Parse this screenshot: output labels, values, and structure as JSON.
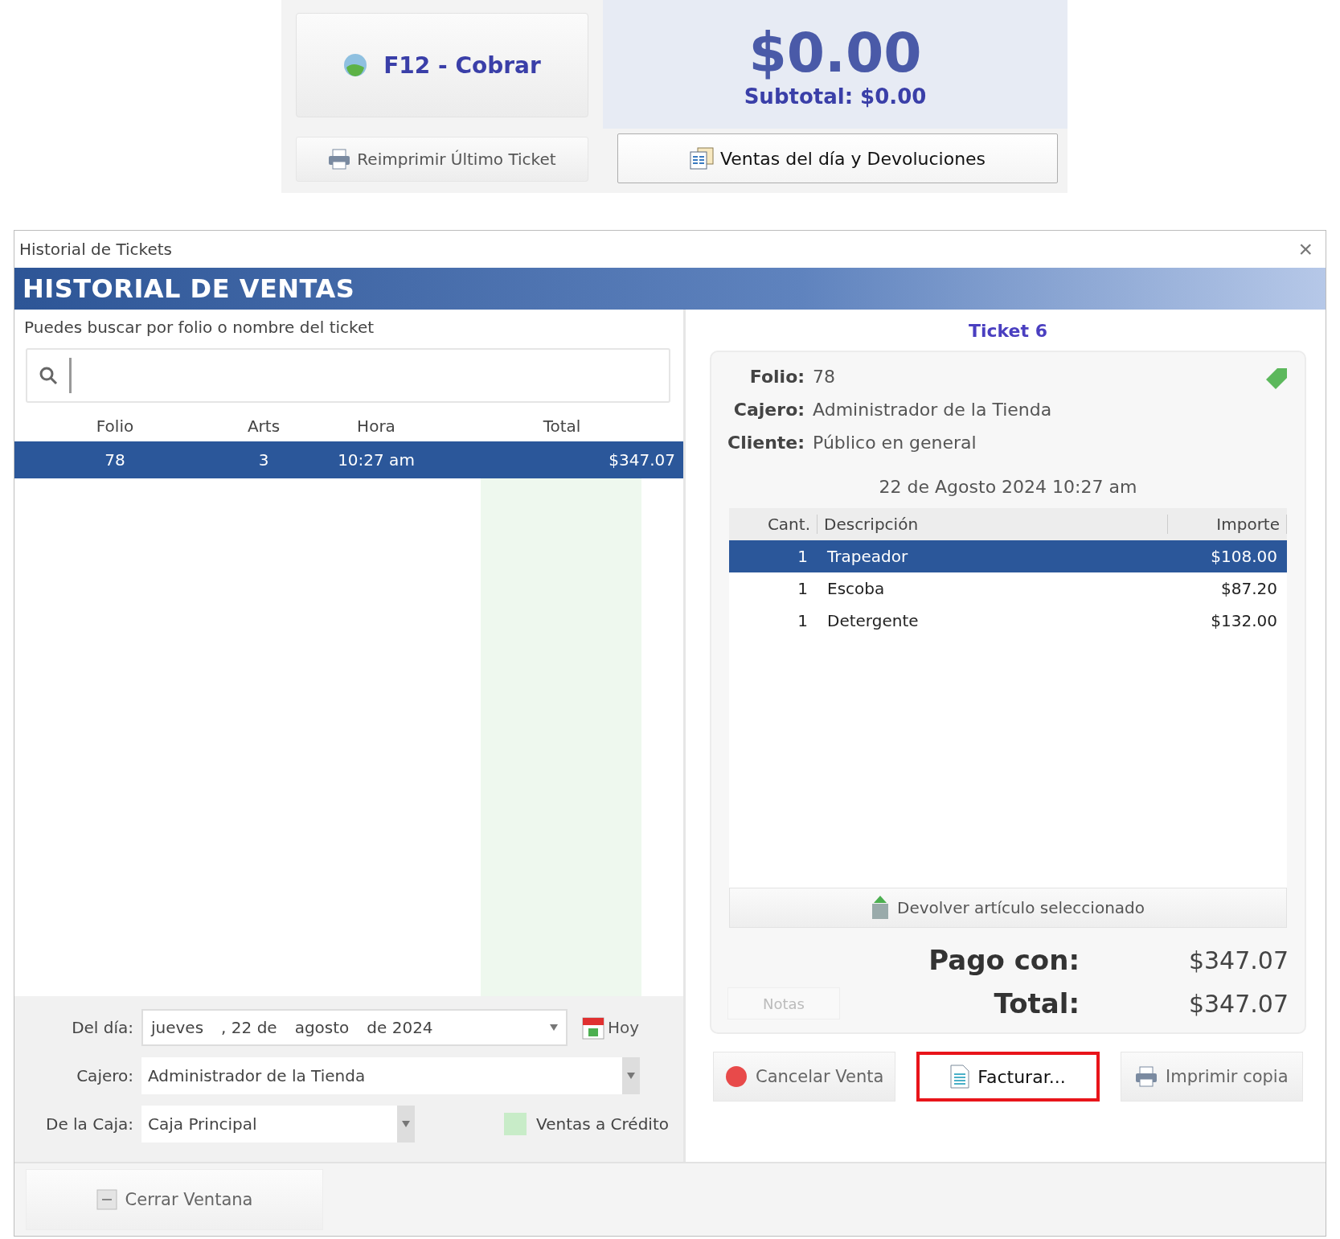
{
  "top_bar": {
    "charge_button": "F12 - Cobrar",
    "total": "$0.00",
    "subtotal": "Subtotal: $0.00",
    "reprint_button": "Reimprimir Último Ticket",
    "sales_button": "Ventas del día y Devoluciones"
  },
  "window": {
    "title": "Historial de Tickets",
    "header": "HISTORIAL DE VENTAS",
    "close": "×"
  },
  "search": {
    "hint": "Puedes buscar por folio o nombre del ticket"
  },
  "tickets": {
    "columns": [
      "Folio",
      "Arts",
      "Hora",
      "Total"
    ],
    "rows": [
      {
        "cells": [
          "78",
          "3",
          "10:27 am",
          "$347.07"
        ],
        "selected": true
      }
    ]
  },
  "filters": {
    "day_label": "Del día:",
    "date": [
      "jueves",
      ", 22 de",
      "agosto",
      "de 2024"
    ],
    "today_button": "Hoy",
    "cashier_label": "Cajero:",
    "cashier": "Administrador de la Tienda",
    "register_label": "De la Caja:",
    "register": "Caja Principal",
    "credit_legend": {
      "label": "Ventas a Crédito",
      "color": "#c8ecc8"
    }
  },
  "ticket": {
    "title": "Ticket 6",
    "fields": [
      {
        "label": "Folio:",
        "value": "78"
      },
      {
        "label": "Cajero:",
        "value": "Administrador de la Tienda"
      },
      {
        "label": "Cliente:",
        "value": "Público en general"
      }
    ],
    "date": "22 de Agosto 2024 10:27 am",
    "columns": [
      "Cant.",
      "Descripción",
      "Importe"
    ],
    "items": [
      {
        "cells": [
          "1",
          "Trapeador",
          "$108.00"
        ],
        "selected": true
      },
      {
        "cells": [
          "1",
          "Escoba",
          "$87.20"
        ],
        "selected": false
      },
      {
        "cells": [
          "1",
          "Detergente",
          "$132.00"
        ],
        "selected": false
      }
    ],
    "return_button": "Devolver artículo seleccionado",
    "notes_button": "Notas",
    "paid_label": "Pago con:",
    "paid": "$347.07",
    "total_label": "Total:",
    "total": "$347.07"
  },
  "actions": [
    {
      "label": "Cancelar Venta",
      "highlighted": false,
      "kind": "cancel"
    },
    {
      "label": "Facturar...",
      "highlighted": true,
      "kind": "invoice"
    },
    {
      "label": "Imprimir copia",
      "highlighted": false,
      "kind": "print"
    }
  ],
  "close_button": "Cerrar Ventana"
}
